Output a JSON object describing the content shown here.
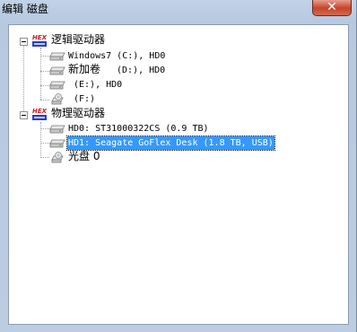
{
  "window": {
    "title": "编辑 磁盘",
    "close_glyph": "✕"
  },
  "tree": {
    "logical_group": {
      "label": "逻辑驱动器",
      "icon": "hex-logo-icon",
      "icon_text": "HEX",
      "items": [
        {
          "label": "Windows7 (C:), HD0",
          "icon": "hard-drive-icon"
        },
        {
          "label_cjk": "新加卷",
          "label_rest": "(D:), HD0",
          "icon": "hard-drive-icon"
        },
        {
          "label": "(E:), HD0",
          "icon": "hard-drive-icon"
        },
        {
          "label": "(F:)",
          "icon": "cd-drive-icon"
        }
      ]
    },
    "physical_group": {
      "label": "物理驱动器",
      "icon": "hex-logo-icon",
      "icon_text": "HEX",
      "items": [
        {
          "label": "HD0: ST31000322CS (0.9 TB)",
          "icon": "hard-drive-icon",
          "selected": false
        },
        {
          "label": "HD1: Seagate GoFlex Desk (1.8 TB, USB)",
          "icon": "hard-drive-icon",
          "selected": true
        },
        {
          "label": "光盘 0",
          "icon": "cd-drive-icon"
        }
      ]
    }
  },
  "colors": {
    "selection": "#3399ff",
    "hex_red": "#cc1a1a",
    "hex_blue": "#2a3fbf"
  }
}
